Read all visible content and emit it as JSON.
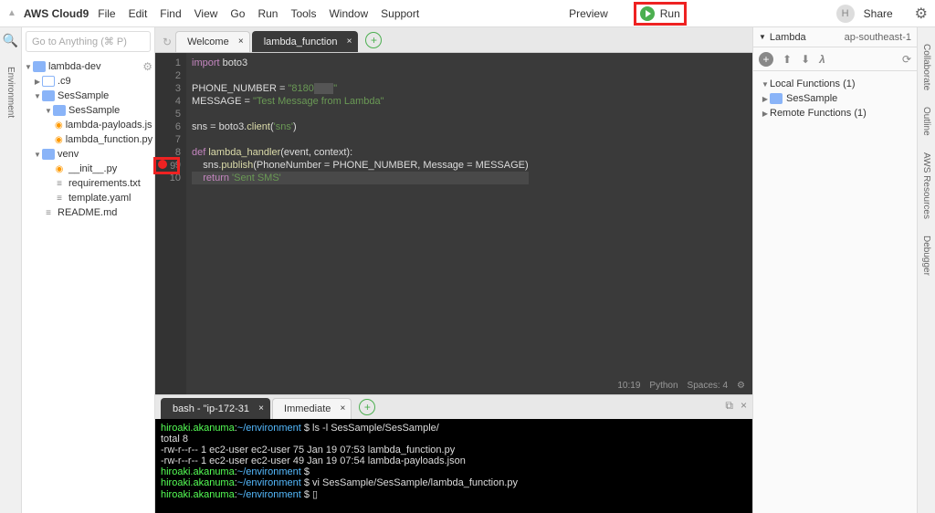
{
  "topbar": {
    "brand": "AWS Cloud9",
    "menus": [
      "File",
      "Edit",
      "Find",
      "View",
      "Go",
      "Run",
      "Tools",
      "Window",
      "Support"
    ],
    "preview": "Preview",
    "run": "Run",
    "share": "Share",
    "avatar": "H"
  },
  "leftRail": {
    "tab": "Environment"
  },
  "rightRail": {
    "tabs": [
      "Collaborate",
      "Outline",
      "AWS Resources",
      "Debugger"
    ]
  },
  "goto": "Go to Anything (⌘ P)",
  "tree": [
    {
      "depth": 0,
      "twist": "▼",
      "icon": "folder",
      "label": "lambda-dev",
      "gear": true
    },
    {
      "depth": 1,
      "twist": "▶",
      "icon": "folder-o",
      "label": ".c9"
    },
    {
      "depth": 1,
      "twist": "▼",
      "icon": "folder",
      "label": "SesSample"
    },
    {
      "depth": 2,
      "twist": "▼",
      "icon": "folder",
      "label": "SesSample"
    },
    {
      "depth": 3,
      "twist": "",
      "icon": "py",
      "label": "lambda-payloads.json"
    },
    {
      "depth": 3,
      "twist": "",
      "icon": "py",
      "label": "lambda_function.py"
    },
    {
      "depth": 1,
      "twist": "▼",
      "icon": "folder",
      "label": "venv"
    },
    {
      "depth": 2,
      "twist": "",
      "icon": "py",
      "label": "__init__.py"
    },
    {
      "depth": 2,
      "twist": "",
      "icon": "file",
      "label": "requirements.txt"
    },
    {
      "depth": 2,
      "twist": "",
      "icon": "file",
      "label": "template.yaml"
    },
    {
      "depth": 1,
      "twist": "",
      "icon": "file",
      "label": "README.md"
    }
  ],
  "editorTabs": [
    {
      "label": "Welcome",
      "active": false
    },
    {
      "label": "lambda_function",
      "active": true
    }
  ],
  "code": {
    "lines": [
      {
        "n": 1,
        "html": "<span class='kw'>import</span> boto3"
      },
      {
        "n": 2,
        "html": ""
      },
      {
        "n": 3,
        "html": "PHONE_NUMBER = <span class='str'>\"8180<span class='sel'>       </span>\"</span>"
      },
      {
        "n": 4,
        "html": "MESSAGE = <span class='str'>\"Test Message from Lambda\"</span>"
      },
      {
        "n": 5,
        "html": ""
      },
      {
        "n": 6,
        "html": "sns = boto3.<span class='fn'>client</span>(<span class='str'>'sns'</span>)"
      },
      {
        "n": 7,
        "html": ""
      },
      {
        "n": 8,
        "html": "<span class='kw'>def</span> <span class='fn'>lambda_handler</span>(event, context):"
      },
      {
        "n": 9,
        "html": "    sns.<span class='fn'>publish</span>(PhoneNumber = PHONE_NUMBER, Message = MESSAGE)",
        "bp": true
      },
      {
        "n": 10,
        "html": "    <span class='kw'>return</span> <span class='str'>'Sent SMS'</span>",
        "cursor": true
      }
    ],
    "status": {
      "pos": "10:19",
      "lang": "Python",
      "spaces": "Spaces: 4"
    }
  },
  "termTabs": [
    {
      "label": "bash - \"ip-172-31",
      "active": true
    },
    {
      "label": "Immediate",
      "active": false
    }
  ],
  "terminal": [
    {
      "u": "hiroaki.akanuma",
      "p": "~/environment",
      "cmd": "ls -l SesSample/SesSample/"
    },
    {
      "plain": "total 8"
    },
    {
      "plain": "-rw-r--r-- 1 ec2-user ec2-user 75 Jan 19 07:53 lambda_function.py"
    },
    {
      "plain": "-rw-r--r-- 1 ec2-user ec2-user 49 Jan 19 07:54 lambda-payloads.json"
    },
    {
      "u": "hiroaki.akanuma",
      "p": "~/environment",
      "cmd": ""
    },
    {
      "u": "hiroaki.akanuma",
      "p": "~/environment",
      "cmd": "vi SesSample/SesSample/lambda_function.py"
    },
    {
      "u": "hiroaki.akanuma",
      "p": "~/environment",
      "cmd": "▯"
    }
  ],
  "lambdaPanel": {
    "title": "Lambda",
    "region": "ap-southeast-1",
    "local": {
      "label": "Local Functions (1)",
      "items": [
        "SesSample"
      ]
    },
    "remote": {
      "label": "Remote Functions (1)"
    }
  }
}
